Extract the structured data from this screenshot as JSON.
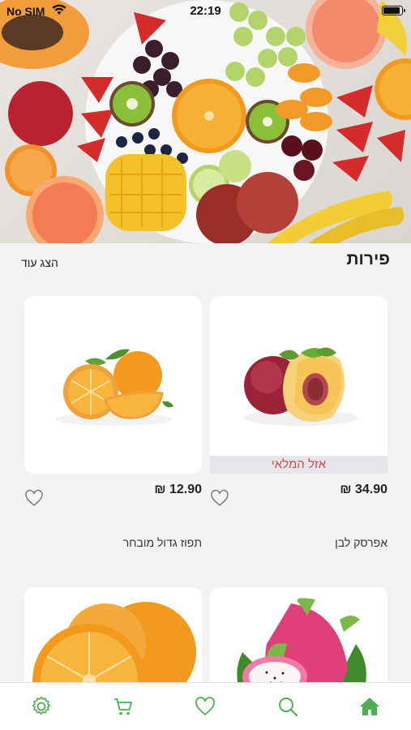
{
  "status_bar": {
    "carrier": "No SIM",
    "time": "22:19"
  },
  "section": {
    "title": "פירות",
    "show_more": "הצג עוד"
  },
  "products": [
    {
      "name": "אפרסק לבן",
      "price": "₪ 34.90",
      "badge": "אזל המלאי"
    },
    {
      "name": "תפוז גדול מובחר",
      "price": "₪ 12.90"
    },
    {
      "name": ""
    },
    {
      "name": ""
    }
  ],
  "tabbar": {
    "items": [
      "home-icon",
      "search-icon",
      "heart-icon",
      "cart-icon",
      "gear-icon"
    ],
    "active": "home-icon",
    "accent": "#4caf50"
  },
  "colors": {
    "accent": "#4caf50",
    "soldout_text": "#c94a4a",
    "background": "#f3f3f3"
  }
}
